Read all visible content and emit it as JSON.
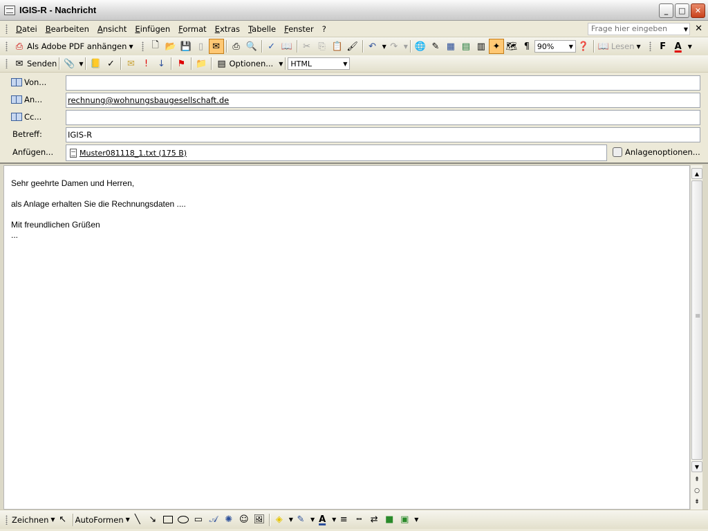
{
  "window": {
    "title": "IGIS-R - Nachricht",
    "minimize": "_",
    "maximize": "□",
    "close": "✕"
  },
  "menu": {
    "items": [
      "Datei",
      "Bearbeiten",
      "Ansicht",
      "Einfügen",
      "Format",
      "Extras",
      "Tabelle",
      "Fenster",
      "?"
    ],
    "ask_placeholder": "Frage hier eingeben",
    "close_doc": "✕"
  },
  "toolbar_standard": {
    "pdf_label": "Als Adobe PDF anhängen",
    "zoom": "90%",
    "read_label": "Lesen",
    "bold_label": "F"
  },
  "toolbar_email": {
    "send_label": "Senden",
    "options_label": "Optionen...",
    "format_value": "HTML"
  },
  "fields": {
    "from_label": "Von...",
    "from_value": "",
    "to_label": "An...",
    "to_value": "rechnung@wohnungsbaugesellschaft.de",
    "cc_label": "Cc...",
    "cc_value": "",
    "subject_label": "Betreff:",
    "subject_value": "IGIS-R",
    "attach_label": "Anfügen...",
    "attachment": "Muster081118_1.txt (175 B)",
    "attach_options": "Anlagenoptionen..."
  },
  "body": {
    "greeting": "Sehr geehrte Damen und Herren,",
    "line1": "als Anlage erhalten Sie die Rechnungsdaten ....",
    "closing": "Mit freundlichen Grüßen",
    "signature": "..."
  },
  "drawbar": {
    "draw_label": "Zeichnen",
    "autoshapes_label": "AutoFormen"
  }
}
